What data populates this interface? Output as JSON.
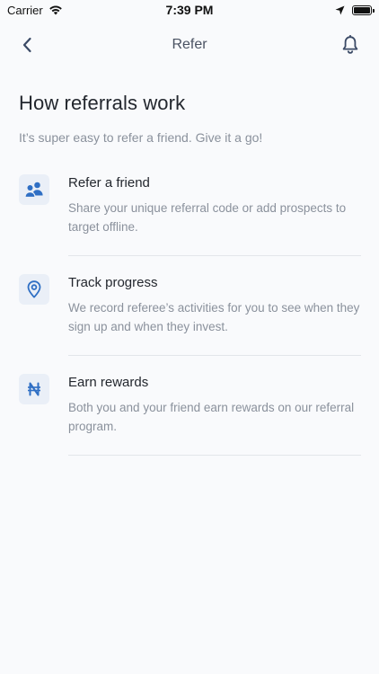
{
  "status_bar": {
    "carrier": "Carrier",
    "time": "7:39 PM",
    "battery_level": 1.0
  },
  "nav": {
    "title": "Refer",
    "back_icon": "chevron-left-icon",
    "bell_icon": "bell-icon"
  },
  "page": {
    "title": "How referrals work",
    "subtitle": "It’s super easy to refer a friend. Give it a go!"
  },
  "steps": [
    {
      "icon": "users-icon",
      "title": "Refer a friend",
      "description": "Share your unique referral code or add prospects to target offline."
    },
    {
      "icon": "location-pin-icon",
      "title": "Track progress",
      "description": "We record referee’s activities for you to see when they sign up and when they invest."
    },
    {
      "icon": "naira-icon",
      "title": "Earn rewards",
      "description": "Both you and your friend earn rewards on our referral program."
    }
  ],
  "colors": {
    "background": "#f9fafc",
    "accent": "#2f6fc4",
    "icon_tile": "#eaeff7",
    "muted_text": "#8a919c"
  }
}
